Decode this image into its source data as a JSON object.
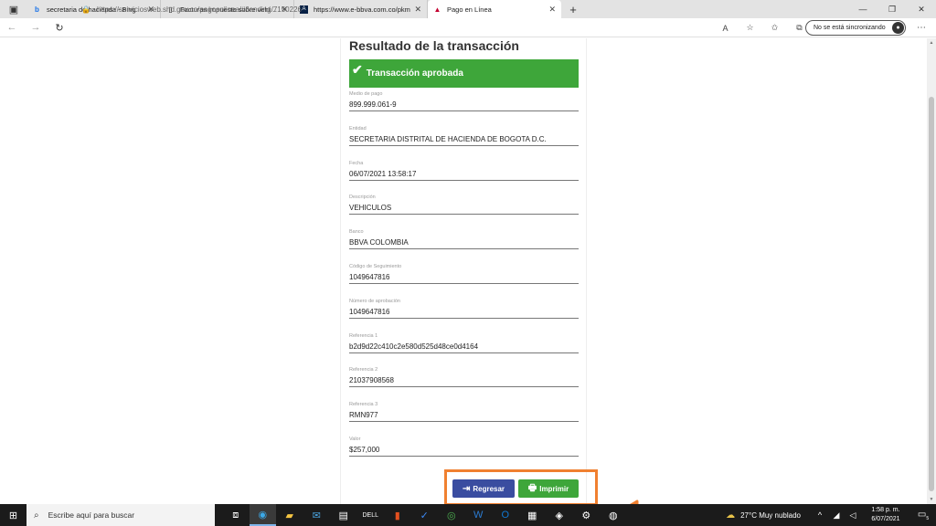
{
  "browser": {
    "tabs": [
      {
        "title": "secretaria de hacienda - Bing",
        "icon": "bing-icon",
        "active": false
      },
      {
        "title": "Facturas impuesto sobre vehícul...",
        "icon": "document-icon",
        "active": false
      },
      {
        "title": "https://www.e-bbva.com.co/pkm",
        "icon": "bbva-icon",
        "active": false
      },
      {
        "title": "Pago en Línea",
        "icon": "angular-icon",
        "active": true
      }
    ],
    "url": "https://serviciosweb.shd.gov.co/pagoenlinea/#/landing/7150226",
    "sync_label": "No se está sincronizando"
  },
  "page": {
    "title": "Resultado de la transacción",
    "status": "Transacción aprobada",
    "status_color": "#3ea63a",
    "fields": [
      {
        "label": "Medio de pago",
        "value": "899.999.061-9"
      },
      {
        "label": "Entidad",
        "value": "SECRETARIA DISTRITAL DE HACIENDA DE BOGOTA D.C."
      },
      {
        "label": "Fecha",
        "value": "06/07/2021 13:58:17"
      },
      {
        "label": "Descripción",
        "value": "VEHICULOS"
      },
      {
        "label": "Banco",
        "value": "BBVA COLOMBIA"
      },
      {
        "label": "Código de Seguimiento",
        "value": "1049647816"
      },
      {
        "label": "Número de aprobación",
        "value": "1049647816"
      },
      {
        "label": "Referencia 1",
        "value": "b2d9d22c410c2e580d525d48ce0d4164"
      },
      {
        "label": "Referencia 2",
        "value": "21037908568"
      },
      {
        "label": "Referencia 3",
        "value": "RMN977"
      },
      {
        "label": "Valor",
        "value": "$257,000"
      }
    ],
    "buttons": {
      "back": "Regresar",
      "print": "Imprimir"
    },
    "highlight_color": "#f08030"
  },
  "taskbar": {
    "search_placeholder": "Escribe aquí para buscar",
    "weather": "27°C  Muy nublado",
    "time": "1:58 p. m.",
    "date": "6/07/2021",
    "notifications": "5"
  }
}
